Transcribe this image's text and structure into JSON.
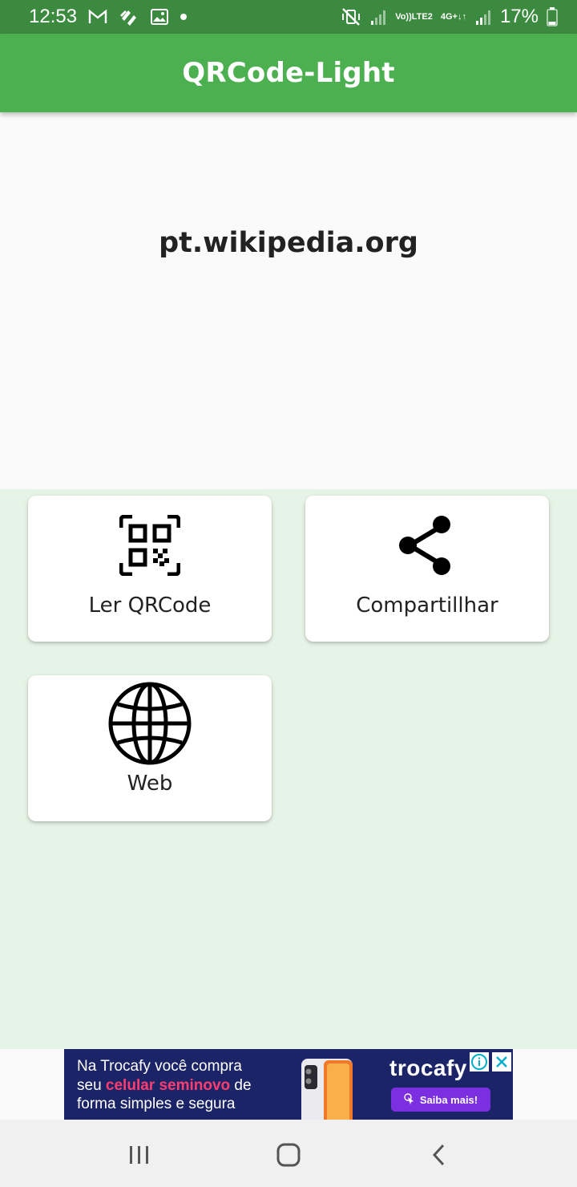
{
  "status_bar": {
    "time": "12:53",
    "battery": "17%",
    "volte_label_top": "Vo))",
    "volte_label_bottom": "LTE2",
    "network_label": "4G+",
    "left_icons": [
      "gmail-icon",
      "app-notification-icon",
      "gallery-icon",
      "dot-icon"
    ],
    "right_icons": [
      "mute-vibrate-icon",
      "signal-icon",
      "signal-icon",
      "battery-icon"
    ]
  },
  "app_bar": {
    "title": "QRCode-Light"
  },
  "result": {
    "text": "pt.wikipedia.org"
  },
  "actions": [
    {
      "label": "Ler QRCode",
      "icon": "qr-scan-icon"
    },
    {
      "label": "Compartillhar",
      "icon": "share-icon"
    },
    {
      "label": "Web",
      "icon": "globe-icon"
    }
  ],
  "ad": {
    "line1": "Na Trocafy você compra",
    "line2_prefix": "seu ",
    "line2_highlight": "celular seminovo",
    "line2_suffix": " de",
    "line3": "forma simples e segura",
    "brand": "trocafy",
    "cta": "Saiba mais!",
    "colors": {
      "background": "#1c2468",
      "highlight": "#ff3d6e",
      "cta": "#7b2fe0"
    }
  },
  "nav_bar": {
    "icons": [
      "recent-apps-icon",
      "home-icon",
      "back-icon"
    ]
  },
  "colors": {
    "status_bar": "#3c8a3f",
    "app_bar": "#4caf50",
    "actions_background": "#e6f4e7"
  }
}
